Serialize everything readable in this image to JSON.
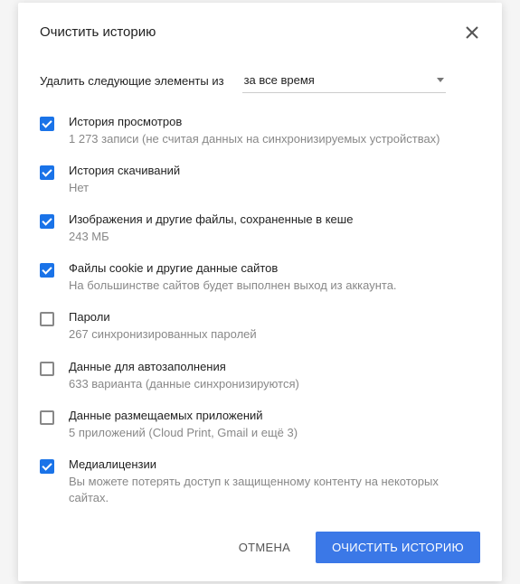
{
  "dialog": {
    "title": "Очистить историю",
    "timeRange": {
      "label": "Удалить следующие элементы из",
      "selected": "за все время"
    },
    "options": [
      {
        "label": "История просмотров",
        "sub": "1 273 записи (не считая данных на синхронизируемых устройствах)",
        "checked": true
      },
      {
        "label": "История скачиваний",
        "sub": "Нет",
        "checked": true
      },
      {
        "label": "Изображения и другие файлы, сохраненные в кеше",
        "sub": "243 МБ",
        "checked": true
      },
      {
        "label": "Файлы cookie и другие данные сайтов",
        "sub": "На большинстве сайтов будет выполнен выход из аккаунта.",
        "checked": true
      },
      {
        "label": "Пароли",
        "sub": "267 синхронизированных паролей",
        "checked": false
      },
      {
        "label": "Данные для автозаполнения",
        "sub": "633 варианта (данные синхронизируются)",
        "checked": false
      },
      {
        "label": "Данные размещаемых приложений",
        "sub": "5 приложений (Cloud Print, Gmail и ещё 3)",
        "checked": false
      },
      {
        "label": "Медиалицензии",
        "sub": "Вы можете потерять доступ к защищенному контенту на некоторых сайтах.",
        "checked": true
      }
    ],
    "buttons": {
      "cancel": "ОТМЕНА",
      "confirm": "ОЧИСТИТЬ ИСТОРИЮ"
    }
  }
}
